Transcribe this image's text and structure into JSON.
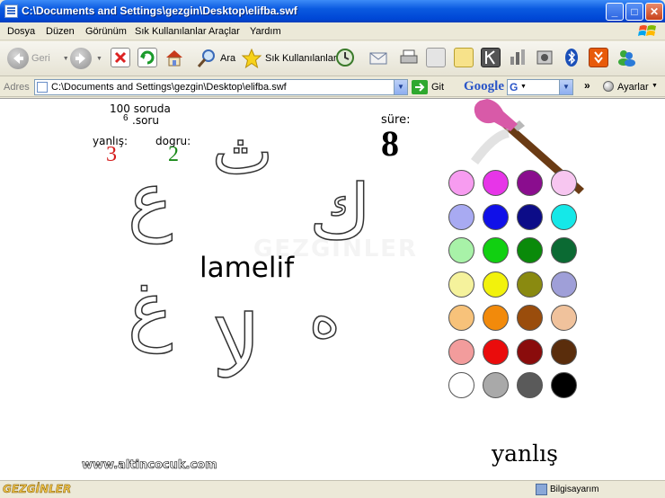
{
  "window": {
    "title": "C:\\Documents and Settings\\gezgin\\Desktop\\elifba.swf",
    "min_label": "_",
    "max_label": "□",
    "close_label": "✕"
  },
  "menu": [
    "Dosya",
    "Düzen",
    "Görünüm",
    "Sık Kullanılanlar",
    "Araçlar",
    "Yardım"
  ],
  "toolbar": {
    "back_label": "Geri",
    "search_label": "Ara",
    "favorites_label": "Sık Kullanılanlar"
  },
  "address": {
    "label": "Adres",
    "value": "C:\\Documents and Settings\\gezgin\\Desktop\\elifba.swf",
    "go_label": "Git",
    "google_label": "Google",
    "chevron": "»",
    "settings_label": "Ayarlar"
  },
  "game": {
    "total_text": "100 soruda",
    "question_no": "6",
    "question_suffix": ".soru",
    "wrong_label": "yanlış:",
    "wrong_count": "3",
    "correct_label": "dogru:",
    "correct_count": "2",
    "time_label": "süre:",
    "time_value": "8",
    "target_word": "lamelif",
    "result_text": "yanlış",
    "website": "www.altincocuk.com",
    "watermark": "GEZGİNLER",
    "letters": [
      "ث",
      "ع",
      "ك",
      "غ",
      "لا",
      "ه"
    ],
    "palette": [
      "#f79cf0",
      "#e735e8",
      "#8a0d8e",
      "#f7c6f0",
      "#a8aaf2",
      "#1010e8",
      "#0c0c88",
      "#15e8e8",
      "#a8f2a8",
      "#11d011",
      "#0a8a0a",
      "#0b6a33",
      "#f5f29c",
      "#f2f20c",
      "#8a8a10",
      "#9f9fd8",
      "#f7c27a",
      "#f28a0b",
      "#9a4d0c",
      "#f0c29c",
      "#f29c9c",
      "#ea0c0c",
      "#8a0c0c",
      "#5a2d0c",
      "#ffffff",
      "#a9a9a9",
      "#5a5a5a",
      "#000000"
    ]
  },
  "status": {
    "zone": "Bilgisayarım",
    "brand": "GEZGİNLER"
  }
}
